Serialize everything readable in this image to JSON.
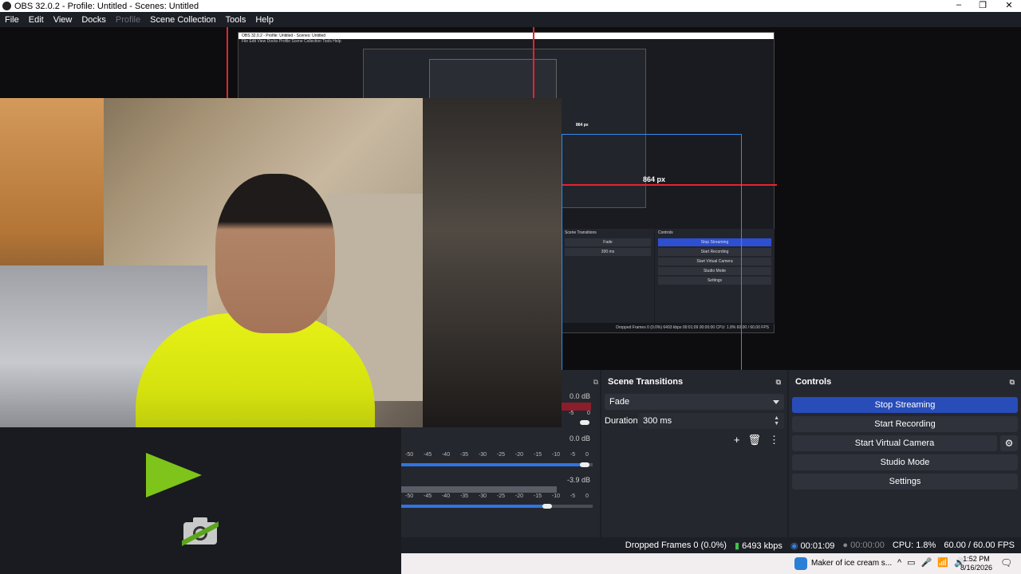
{
  "window": {
    "title": "OBS 32.0.2 - Profile: Untitled - Scenes: Untitled",
    "minimize": "–",
    "restore": "❐",
    "close": "✕"
  },
  "menu": [
    {
      "label": "File",
      "enabled": true
    },
    {
      "label": "Edit",
      "enabled": true
    },
    {
      "label": "View",
      "enabled": true
    },
    {
      "label": "Docks",
      "enabled": true
    },
    {
      "label": "Profile",
      "enabled": false
    },
    {
      "label": "Scene Collection",
      "enabled": true
    },
    {
      "label": "Tools",
      "enabled": true
    },
    {
      "label": "Help",
      "enabled": true
    }
  ],
  "preview": {
    "measure_label_large": "864 px",
    "measure_label_small": "864 px"
  },
  "nested_preview": {
    "scene_transitions": "Scene Transitions",
    "controls": "Controls",
    "fade": "Fade",
    "duration_label": "Duration",
    "duration_value": "300 ms",
    "buttons": [
      "Stop Streaming",
      "Start Recording",
      "Start Virtual Camera",
      "Studio Mode",
      "Settings"
    ],
    "status": "Dropped Frames 0 (0.0%)   6493 kbps   00:01:09   00:00:00   CPU: 1.8%   60.00 / 60.00 FPS"
  },
  "mixer": {
    "db_top": "0.0 dB",
    "db_mid": "0.0 dB",
    "db_bottom": "-3.9 dB",
    "small_value": "-5",
    "small_value2": "0",
    "ticks": [
      "-50",
      "-45",
      "-40",
      "-35",
      "-30",
      "-25",
      "-20",
      "-15",
      "-10",
      "-5",
      "0"
    ]
  },
  "transitions": {
    "title": "Scene Transitions",
    "selected": "Fade",
    "duration_label": "Duration",
    "duration_value": "300 ms",
    "add_icon": "+",
    "remove_icon": "🗑",
    "more_icon": "⋮"
  },
  "controls": {
    "title": "Controls",
    "stop_streaming": "Stop Streaming",
    "start_recording": "Start Recording",
    "start_virtual_camera": "Start Virtual Camera",
    "studio_mode": "Studio Mode",
    "settings": "Settings"
  },
  "status": {
    "dropped_frames": "Dropped Frames 0 (0.0%)",
    "bitrate": "6493 kbps",
    "stream_time": "00:01:09",
    "record_time": "00:00:00",
    "cpu": "CPU: 1.8%",
    "fps": "60.00 / 60.00 FPS"
  },
  "taskbar": {
    "window_text": "Maker of ice cream s...",
    "time": "1:52 PM",
    "date": "8/16/2026"
  },
  "colors": {
    "accent_blue": "#284cb8",
    "green_icon": "#7ec41a",
    "signal_green": "#3fc24a",
    "guide_red": "#e8222c",
    "guide_blue": "#2f8cf0"
  }
}
